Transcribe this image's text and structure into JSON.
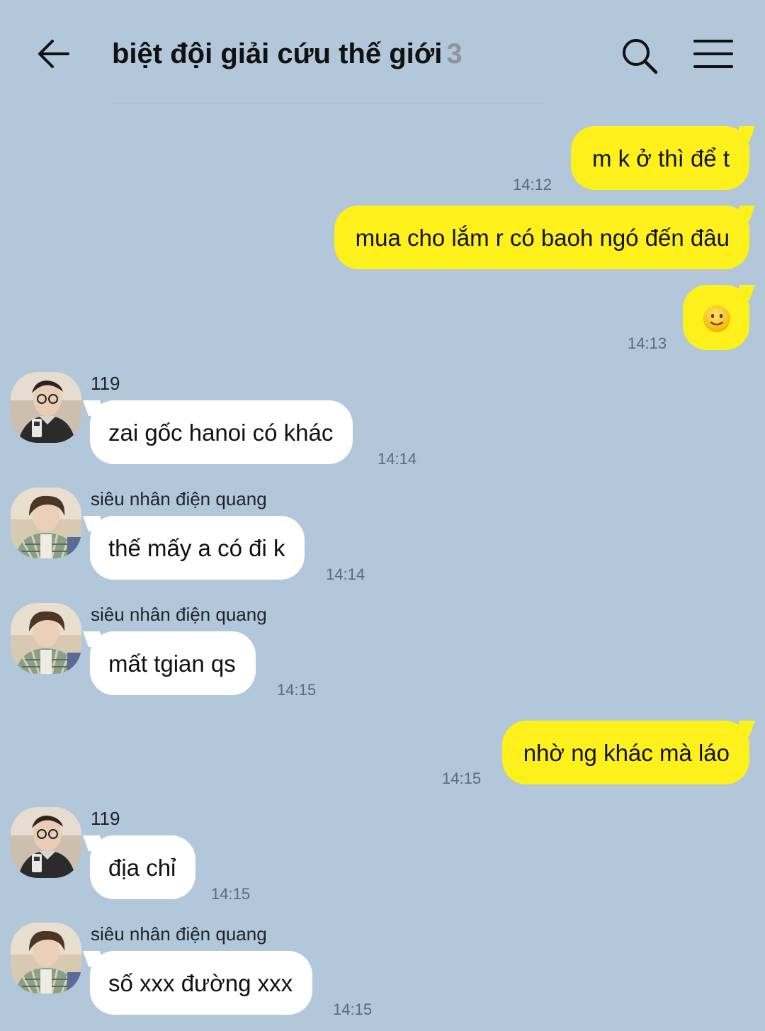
{
  "header": {
    "title": "biệt đội giải cứu thế giới",
    "member_count": "3",
    "back_icon": "arrow-left-icon",
    "search_icon": "search-icon",
    "menu_icon": "hamburger-menu-icon"
  },
  "colors": {
    "background": "#b2c7da",
    "my_bubble": "#fef01b",
    "their_bubble": "#ffffff"
  },
  "messages": [
    {
      "from": "me",
      "text": "m k ở thì để t",
      "time": "14:12"
    },
    {
      "from": "me",
      "text": "mua cho lắm r có baoh ngó đến đâu",
      "time": ""
    },
    {
      "from": "me",
      "emoji": "slightly-smiling-face-emoji",
      "time": "14:13"
    },
    {
      "from": "119",
      "sender": "119",
      "text": "zai gốc hanoi có khác",
      "time": "14:14"
    },
    {
      "from": "sieu",
      "sender": "siêu nhân điện quang",
      "text": "thế mấy a có đi k",
      "time": "14:14"
    },
    {
      "from": "sieu",
      "sender": "siêu nhân điện quang",
      "text": "mất tgian qs",
      "time": "14:15"
    },
    {
      "from": "me",
      "text": "nhờ ng khác mà láo",
      "time": "14:15"
    },
    {
      "from": "119",
      "sender": "119",
      "text": "địa chỉ",
      "time": "14:15"
    },
    {
      "from": "sieu",
      "sender": "siêu nhân điện quang",
      "text": "số xxx đường xxx",
      "time": "14:15"
    }
  ]
}
